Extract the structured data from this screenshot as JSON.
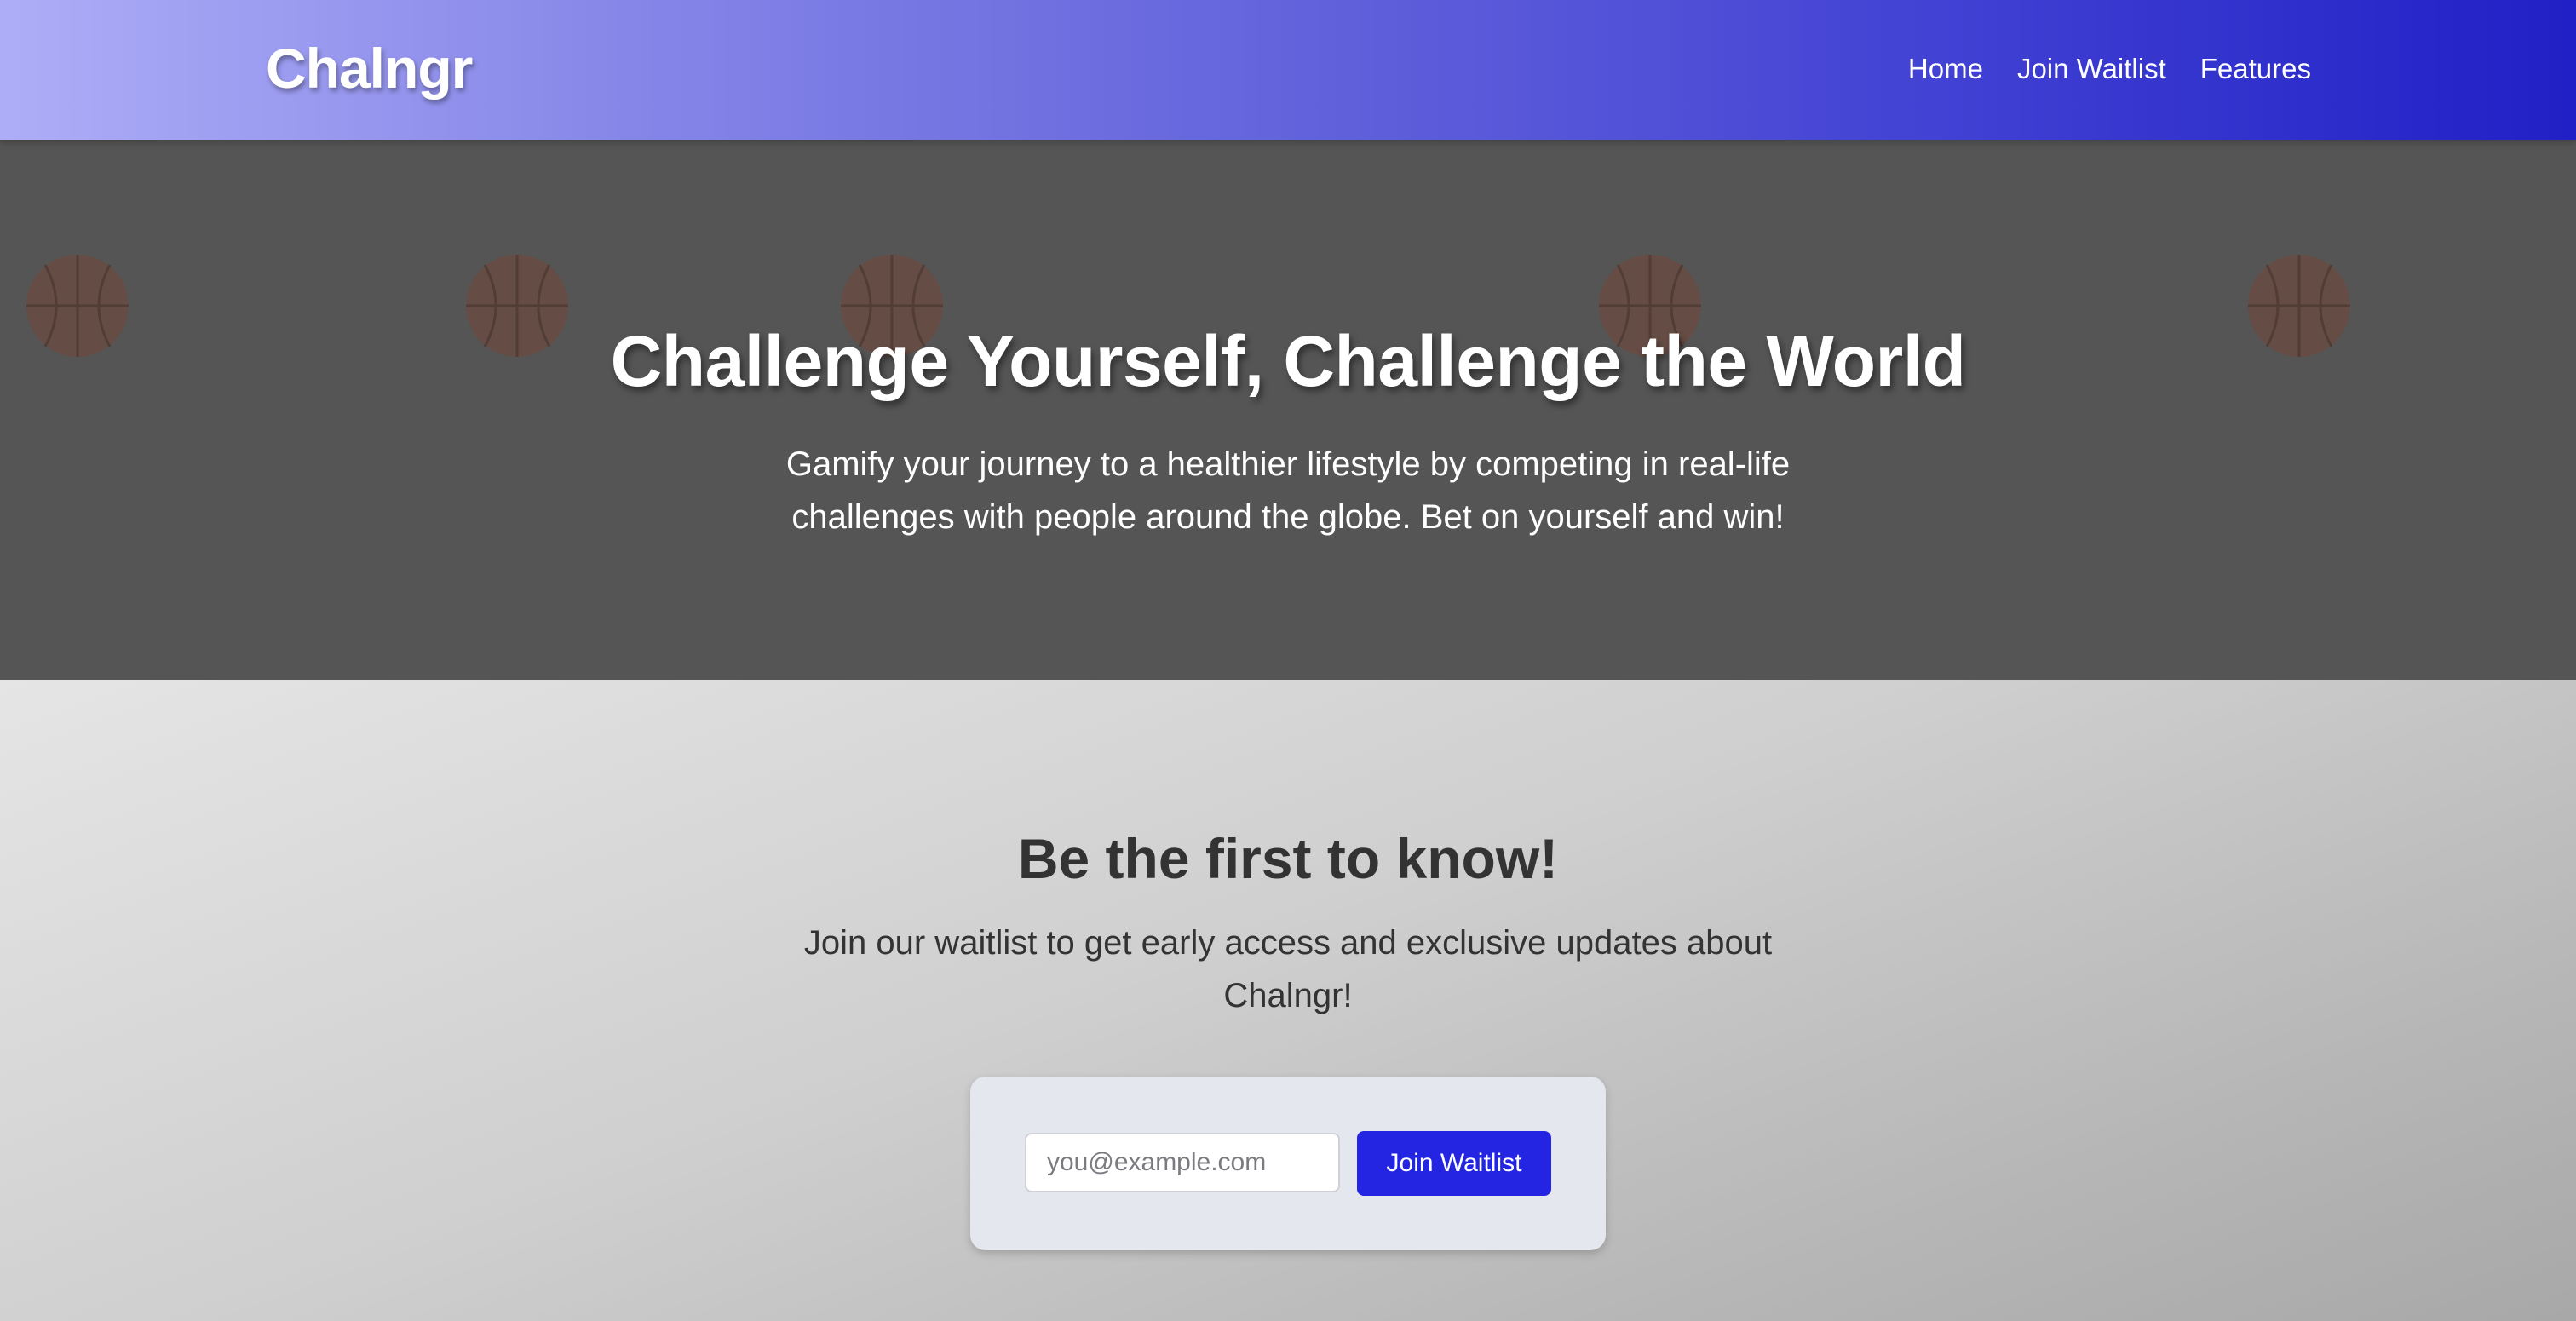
{
  "header": {
    "logo": "Chalngr",
    "nav": [
      "Home",
      "Join Waitlist",
      "Features"
    ]
  },
  "hero": {
    "title": "Challenge Yourself, Challenge the World",
    "subtitle": "Gamify your journey to a healthier lifestyle by competing in real-life challenges with people around the globe. Bet on yourself and win!",
    "decor_icon": "basketball-icon"
  },
  "waitlist": {
    "title": "Be the first to know!",
    "subtitle": "Join our waitlist to get early access and exclusive updates about Chalngr!",
    "email_placeholder": "you@example.com",
    "email_value": "",
    "button_label": "Join Waitlist"
  },
  "colors": {
    "header_gradient_start": "#adadf7",
    "header_gradient_end": "#2020c6",
    "hero_bg": "#555555",
    "button": "#2424e3",
    "form_card": "#e5e7ef"
  }
}
